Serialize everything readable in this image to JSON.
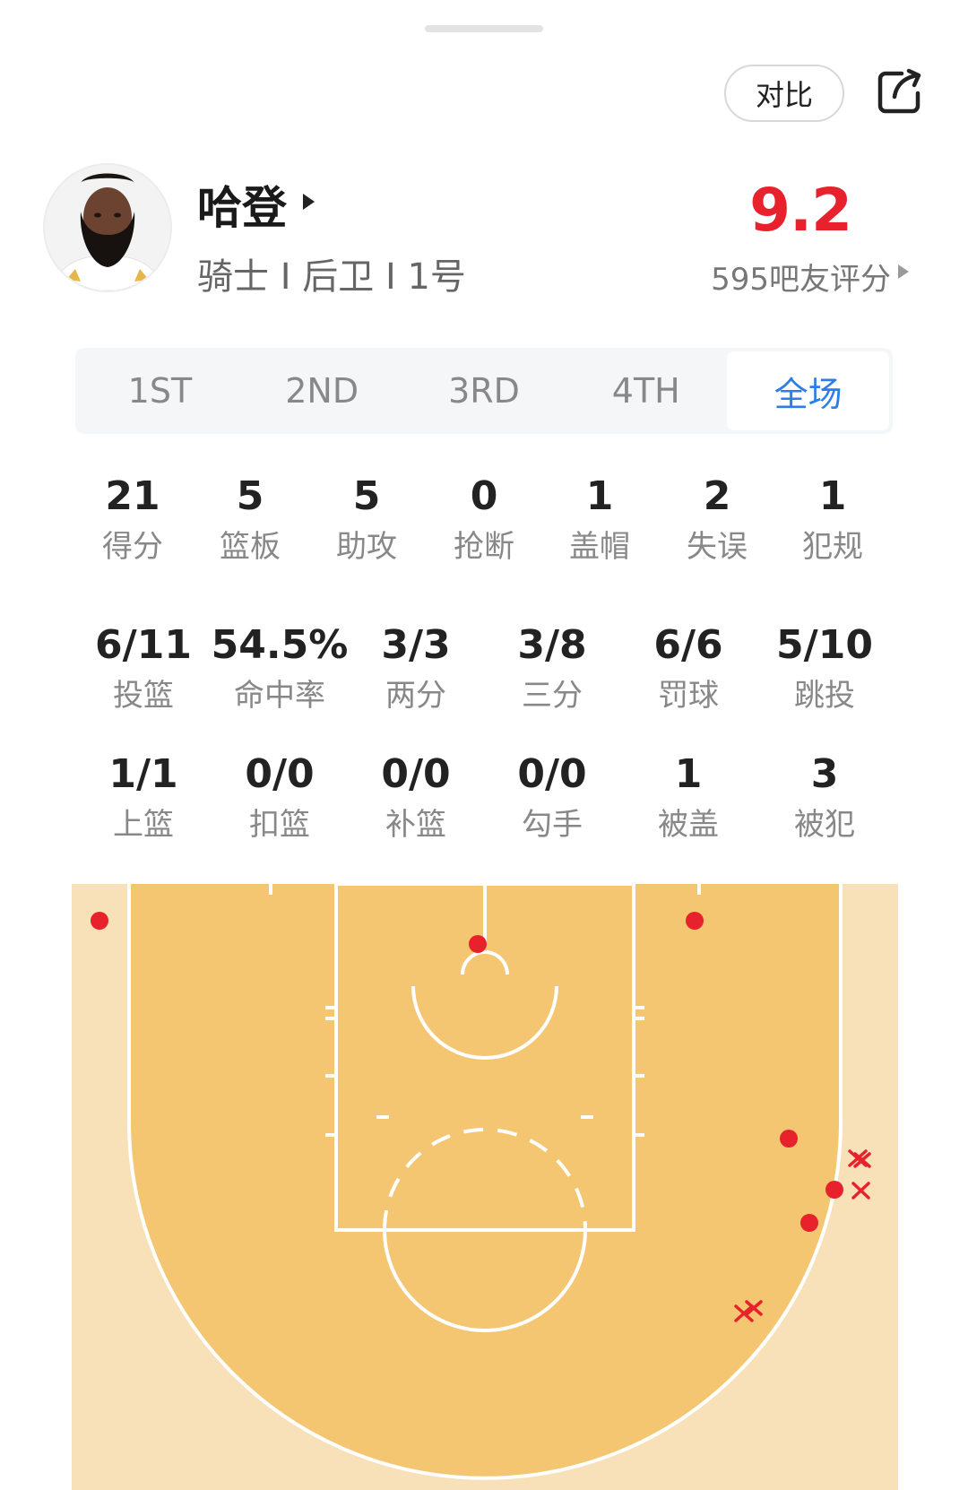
{
  "header": {
    "compare_label": "对比"
  },
  "player": {
    "name": "哈登",
    "team": "骑士",
    "position": "后卫",
    "number": "1号",
    "rating": "9.2",
    "rating_count": "595吧友评分"
  },
  "period_tabs": [
    {
      "label": "1ST",
      "active": false
    },
    {
      "label": "2ND",
      "active": false
    },
    {
      "label": "3RD",
      "active": false
    },
    {
      "label": "4TH",
      "active": false
    },
    {
      "label": "全场",
      "active": true
    }
  ],
  "basic_stats": [
    {
      "value": "21",
      "label": "得分"
    },
    {
      "value": "5",
      "label": "篮板"
    },
    {
      "value": "5",
      "label": "助攻"
    },
    {
      "value": "0",
      "label": "抢断"
    },
    {
      "value": "1",
      "label": "盖帽"
    },
    {
      "value": "2",
      "label": "失误"
    },
    {
      "value": "1",
      "label": "犯规"
    }
  ],
  "shooting_stats": [
    {
      "value": "6/11",
      "label": "投篮"
    },
    {
      "value": "54.5%",
      "label": "命中率"
    },
    {
      "value": "3/3",
      "label": "两分"
    },
    {
      "value": "3/8",
      "label": "三分"
    },
    {
      "value": "6/6",
      "label": "罚球"
    },
    {
      "value": "5/10",
      "label": "跳投"
    }
  ],
  "shot_type_stats": [
    {
      "value": "1/1",
      "label": "上篮"
    },
    {
      "value": "0/0",
      "label": "扣篮"
    },
    {
      "value": "0/0",
      "label": "补篮"
    },
    {
      "value": "0/0",
      "label": "勾手"
    },
    {
      "value": "1",
      "label": "被盖"
    },
    {
      "value": "3",
      "label": "被犯"
    }
  ],
  "shot_chart": {
    "made_color": "#e8222c",
    "missed_color": "#e8222c",
    "made_marker": "filled-dot",
    "missed_marker": "x-mark",
    "made": 6,
    "missed": 5
  }
}
